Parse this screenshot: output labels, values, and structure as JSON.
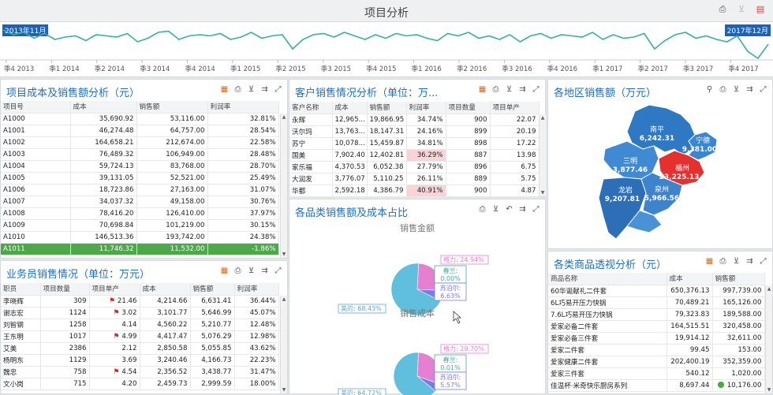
{
  "page": {
    "title": "项目分析"
  },
  "timeline": {
    "start_label": "2013年11月",
    "end_label": "2017年12月",
    "ticks": [
      "季4 2013",
      "季1 2014",
      "季2 2014",
      "季3 2014",
      "季4 2014",
      "季1 2015",
      "季2 2015",
      "季3 2015",
      "季4 2015",
      "季1 2016",
      "季2 2016",
      "季3 2016",
      "季4 2016",
      "季1 2017",
      "季2 2017",
      "季3 2017",
      "季4 2017"
    ],
    "series": [
      38,
      34,
      36,
      31,
      35,
      30,
      32,
      33,
      29,
      34,
      33,
      32,
      35,
      28,
      31,
      36,
      37,
      30,
      33,
      34,
      33,
      35,
      30,
      32,
      36,
      31,
      33,
      34,
      22,
      30,
      34,
      35,
      32,
      36,
      33,
      30,
      34,
      31,
      35,
      33,
      34,
      31,
      29,
      35,
      33,
      36,
      31,
      33,
      30,
      34,
      28,
      33,
      35,
      31,
      34,
      33,
      32,
      36,
      30,
      34,
      31,
      32,
      35,
      22,
      29,
      34,
      36,
      31,
      33,
      30,
      28,
      33,
      20,
      14,
      26
    ]
  },
  "cost_panel": {
    "title": "项目成本及销售额分析（元）",
    "headers": [
      "项目号",
      "成本",
      "销售额",
      "利润率"
    ],
    "rows": [
      [
        "A1000",
        "35,690.92",
        "53,116.00",
        "32.81%"
      ],
      [
        "A1001",
        "46,274.48",
        "64,757.00",
        "28.54%"
      ],
      [
        "A1002",
        "164,658.21",
        "212,674.00",
        "22.58%"
      ],
      [
        "A1003",
        "76,489.32",
        "106,949.00",
        "28.48%"
      ],
      [
        "A1004",
        "59,724.13",
        "83,768.00",
        "28.70%"
      ],
      [
        "A1005",
        "39,131.05",
        "52,521.00",
        "25.49%"
      ],
      [
        "A1006",
        "18,723.86",
        "27,163.00",
        "31.07%"
      ],
      [
        "A1007",
        "34,037.32",
        "49,158.00",
        "30.76%"
      ],
      [
        "A1008",
        "78,416.20",
        "126,410.00",
        "37.97%"
      ],
      [
        "A1009",
        "70,698.84",
        "101,219.00",
        "30.15%"
      ],
      [
        "A1010",
        "146,513.36",
        "193,742.00",
        "24.38%"
      ],
      [
        "A1011",
        "11,746.32",
        "11,532.00",
        "-1.86%"
      ]
    ]
  },
  "sales_panel": {
    "title": "业务员销售情况（单位：万元）",
    "headers": [
      "职员",
      "项目数量",
      "项目单产",
      "成本",
      "销售额",
      "利润率"
    ],
    "rows": [
      [
        "李晓辉",
        "309",
        "21.46",
        "4,214.66",
        "6,631.41",
        "36.44%"
      ],
      [
        "谢志宏",
        "1124",
        "3.02",
        "3,101.77",
        "5,646.99",
        "45.07%"
      ],
      [
        "刘智钢",
        "1258",
        "4.14",
        "4,560.22",
        "5,210.77",
        "12.48%"
      ],
      [
        "王东明",
        "1017",
        "4.99",
        "4,417.47",
        "5,076.29",
        "12.98%"
      ],
      [
        "艾美",
        "2386",
        "2.12",
        "2,850.58",
        "5,055.85",
        "43.62%"
      ],
      [
        "杨明东",
        "1129",
        "3.69",
        "3,240.46",
        "4,166.73",
        "22.23%"
      ],
      [
        "魏忠",
        "758",
        "4.54",
        "2,356.52",
        "3,438.77",
        "31.47%"
      ],
      [
        "文小岗",
        "715",
        "4.20",
        "2,459.73",
        "2,999.59",
        "18.00%"
      ]
    ],
    "flag_rows": [
      0,
      1,
      3,
      6
    ]
  },
  "customer_panel": {
    "title": "客户销售情况分析（单位：万...",
    "headers": [
      "客户名称",
      "成本",
      "销售额",
      "利润率",
      "项目数量",
      "项目单产"
    ],
    "rows": [
      [
        "永辉",
        "12,965...",
        "19,866.95",
        "34.74%",
        "900",
        "22.07"
      ],
      [
        "沃尔玛",
        "13,763...",
        "18,147.31",
        "24.16%",
        "899",
        "20.19"
      ],
      [
        "苏宁",
        "10,078...",
        "15,459.87",
        "34.81%",
        "898",
        "17.22"
      ],
      [
        "国美",
        "7,902.40",
        "12,402.81",
        "36.29%",
        "887",
        "13.98"
      ],
      [
        "家乐福",
        "4,370.53",
        "6,052.38",
        "27.79%",
        "896",
        "6.75"
      ],
      [
        "大润发",
        "3,776.07",
        "5,110.25",
        "26.11%",
        "889",
        "5.75"
      ],
      [
        "华都",
        "2,592.18",
        "4,386.79",
        "40.91%",
        "900",
        "4.87"
      ]
    ],
    "pink_rows": [
      3,
      6
    ]
  },
  "pie_panel": {
    "title": "各品类销售额及成本占比",
    "chart_data": [
      {
        "type": "pie",
        "title": "销售金额",
        "labels": [
          "格力",
          "春兰",
          "苏泊尔",
          "美的"
        ],
        "values": [
          24.94,
          0.0,
          6.63,
          68.43
        ],
        "display": [
          "格力: 24.94%",
          "春兰: 0.00%",
          "苏泊尔: 6.63%",
          "美的: 68.43%"
        ],
        "colors": [
          "#e57fd0",
          "#3fae9a",
          "#7b7be8",
          "#5fbfdc"
        ]
      },
      {
        "type": "pie",
        "title": "销售成本",
        "labels": [
          "格力",
          "春兰",
          "苏泊尔",
          "美的"
        ],
        "values": [
          29.7,
          0.01,
          5.57,
          64.72
        ],
        "display": [
          "格力: 29.70%",
          "春兰: 0.01%",
          "苏泊尔: 5.57%",
          "美的: 64.72%"
        ],
        "colors": [
          "#e57fd0",
          "#3fae9a",
          "#7b7be8",
          "#5fbfdc"
        ]
      }
    ]
  },
  "region_panel": {
    "title": "各地区销售额（万元）",
    "regions": [
      {
        "name": "南平",
        "value": "6,242.31"
      },
      {
        "name": "宁德",
        "value": "9,381.00"
      },
      {
        "name": "三明",
        "value": "3,877.46"
      },
      {
        "name": "福州",
        "value": "23,225.13"
      },
      {
        "name": "龙岩",
        "value": "9,207.81"
      },
      {
        "name": "泉州",
        "value": "5,966.56"
      }
    ]
  },
  "goods_panel": {
    "title": "各类商品透视分析（元）",
    "headers": [
      "商品名称",
      "成本",
      "销售额"
    ],
    "rows": [
      [
        "60华诞献礼二件套",
        "650,376.13",
        "997,739.00"
      ],
      [
        "6L巧易开压力快锅",
        "70,489.21",
        "165,126.00"
      ],
      [
        "7.6L巧易开压力快锅",
        "79,323.83",
        "189,588.00"
      ],
      [
        "爱家必备二件套",
        "164,515.51",
        "320,458.00"
      ],
      [
        "爱家必备三件套",
        "19,914.12",
        "32,611.00"
      ],
      [
        "爱家二件套",
        "99.45",
        "153.00"
      ],
      [
        "爱家健康二件套",
        "202,400.19",
        "352,359.00"
      ],
      [
        "爱家三件套",
        "540.12",
        "1,020.00"
      ],
      [
        "佳温杯·米奇快乐厨房系列",
        "8,697.44",
        "10,176.00"
      ]
    ]
  }
}
